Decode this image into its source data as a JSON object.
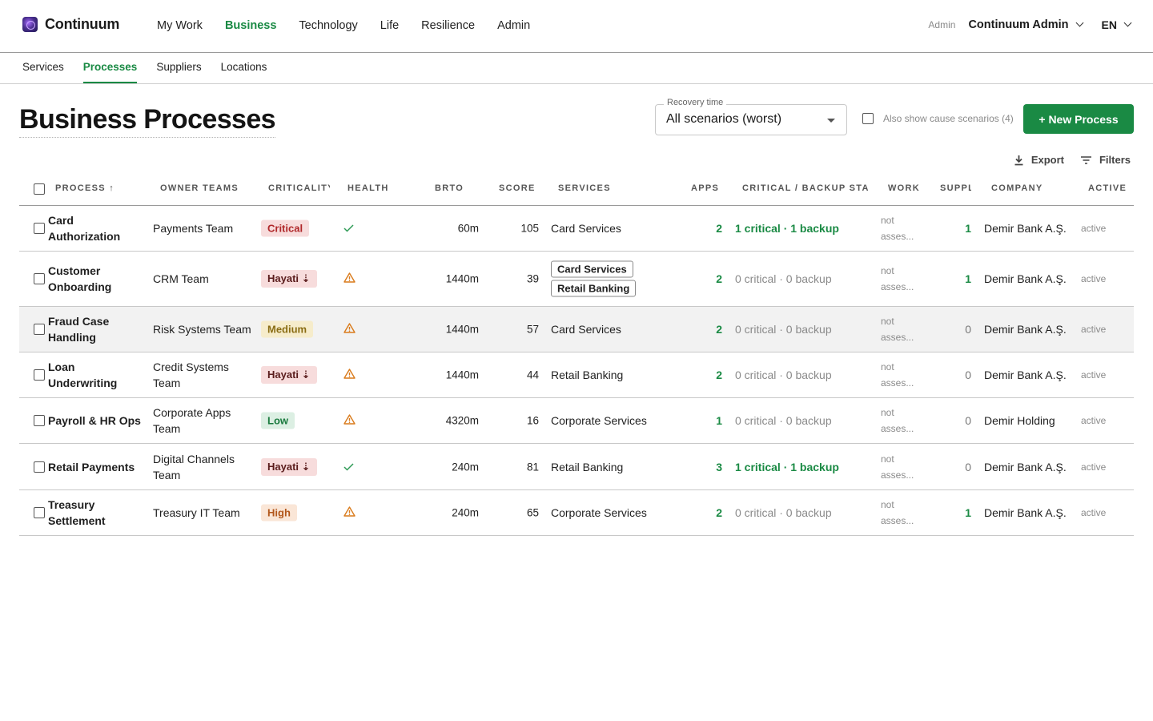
{
  "brand": {
    "name": "Continuum"
  },
  "nav": {
    "items": [
      "My Work",
      "Business",
      "Technology",
      "Life",
      "Resilience",
      "Admin"
    ],
    "active": "Business"
  },
  "user": {
    "role": "Admin",
    "name": "Continuum Admin",
    "lang": "EN"
  },
  "subnav": {
    "items": [
      "Services",
      "Processes",
      "Suppliers",
      "Locations"
    ],
    "active": "Processes"
  },
  "page": {
    "title": "Business Processes",
    "recovery_label": "Recovery time",
    "recovery_value": "All scenarios (worst)",
    "cause_label": "Also show cause scenarios (4)",
    "new_button": "+ New Process",
    "export_label": "Export",
    "filters_label": "Filters"
  },
  "table": {
    "headers": {
      "process": "Process ↑",
      "owner": "Owner Teams",
      "criticality": "Criticality",
      "health": "Health",
      "brto": "BRTO",
      "score": "Score",
      "services": "Services",
      "apps": "Apps",
      "staff": "Critical / Backup Staff",
      "work": "Work",
      "suppliers": "Suppl",
      "company": "Company",
      "active": "Active"
    },
    "rows": [
      {
        "name": "Card Authorization",
        "owner": "Payments Team",
        "criticality": "Critical",
        "crit_class": "critical",
        "health": "check",
        "brto": "60m",
        "score": "105",
        "services": [
          "Card Services"
        ],
        "services_chips": false,
        "apps": "2",
        "staff": "1 critical · 1 backup",
        "staff_ok": true,
        "work": "not asses...",
        "suppliers": "1",
        "company": "Demir Bank A.Ş.",
        "active": "active",
        "highlight": false
      },
      {
        "name": "Customer Onboarding",
        "owner": "CRM Team",
        "criticality": "Hayati ⇣",
        "crit_class": "hayati",
        "health": "warning",
        "brto": "1440m",
        "score": "39",
        "services": [
          "Card Services",
          "Retail Banking"
        ],
        "services_chips": true,
        "apps": "2",
        "staff": "0 critical · 0 backup",
        "staff_ok": false,
        "work": "not asses...",
        "suppliers": "1",
        "company": "Demir Bank A.Ş.",
        "active": "active",
        "highlight": false
      },
      {
        "name": "Fraud Case Handling",
        "owner": "Risk Systems Team",
        "criticality": "Medium",
        "crit_class": "medium",
        "health": "warning",
        "brto": "1440m",
        "score": "57",
        "services": [
          "Card Services"
        ],
        "services_chips": false,
        "apps": "2",
        "staff": "0 critical · 0 backup",
        "staff_ok": false,
        "work": "not asses...",
        "suppliers": "0",
        "company": "Demir Bank A.Ş.",
        "active": "active",
        "highlight": true
      },
      {
        "name": "Loan Underwriting",
        "owner": "Credit Systems Team",
        "criticality": "Hayati ⇣",
        "crit_class": "hayati",
        "health": "warning",
        "brto": "1440m",
        "score": "44",
        "services": [
          "Retail Banking"
        ],
        "services_chips": false,
        "apps": "2",
        "staff": "0 critical · 0 backup",
        "staff_ok": false,
        "work": "not asses...",
        "suppliers": "0",
        "company": "Demir Bank A.Ş.",
        "active": "active",
        "highlight": false
      },
      {
        "name": "Payroll & HR Ops",
        "owner": "Corporate Apps Team",
        "criticality": "Low",
        "crit_class": "low",
        "health": "warning",
        "brto": "4320m",
        "score": "16",
        "services": [
          "Corporate Services"
        ],
        "services_chips": false,
        "apps": "1",
        "staff": "0 critical · 0 backup",
        "staff_ok": false,
        "work": "not asses...",
        "suppliers": "0",
        "company": "Demir Holding",
        "active": "active",
        "highlight": false
      },
      {
        "name": "Retail Payments",
        "owner": "Digital Channels Team",
        "criticality": "Hayati ⇣",
        "crit_class": "hayati",
        "health": "check",
        "brto": "240m",
        "score": "81",
        "services": [
          "Retail Banking"
        ],
        "services_chips": false,
        "apps": "3",
        "staff": "1 critical · 1 backup",
        "staff_ok": true,
        "work": "not asses...",
        "suppliers": "0",
        "company": "Demir Bank A.Ş.",
        "active": "active",
        "highlight": false
      },
      {
        "name": "Treasury Settlement",
        "owner": "Treasury IT Team",
        "criticality": "High",
        "crit_class": "high",
        "health": "warning",
        "brto": "240m",
        "score": "65",
        "services": [
          "Corporate Services"
        ],
        "services_chips": false,
        "apps": "2",
        "staff": "0 critical · 0 backup",
        "staff_ok": false,
        "work": "not asses...",
        "suppliers": "1",
        "company": "Demir Bank A.Ş.",
        "active": "active",
        "highlight": false
      }
    ]
  },
  "colors": {
    "accent": "#1a8a44",
    "check": "#2e9a56",
    "warning": "#d97a1a",
    "critical_bg": "#f7dcdc",
    "medium_bg": "#f6eccb",
    "low_bg": "#dcefe3",
    "high_bg": "#fae6d7"
  }
}
